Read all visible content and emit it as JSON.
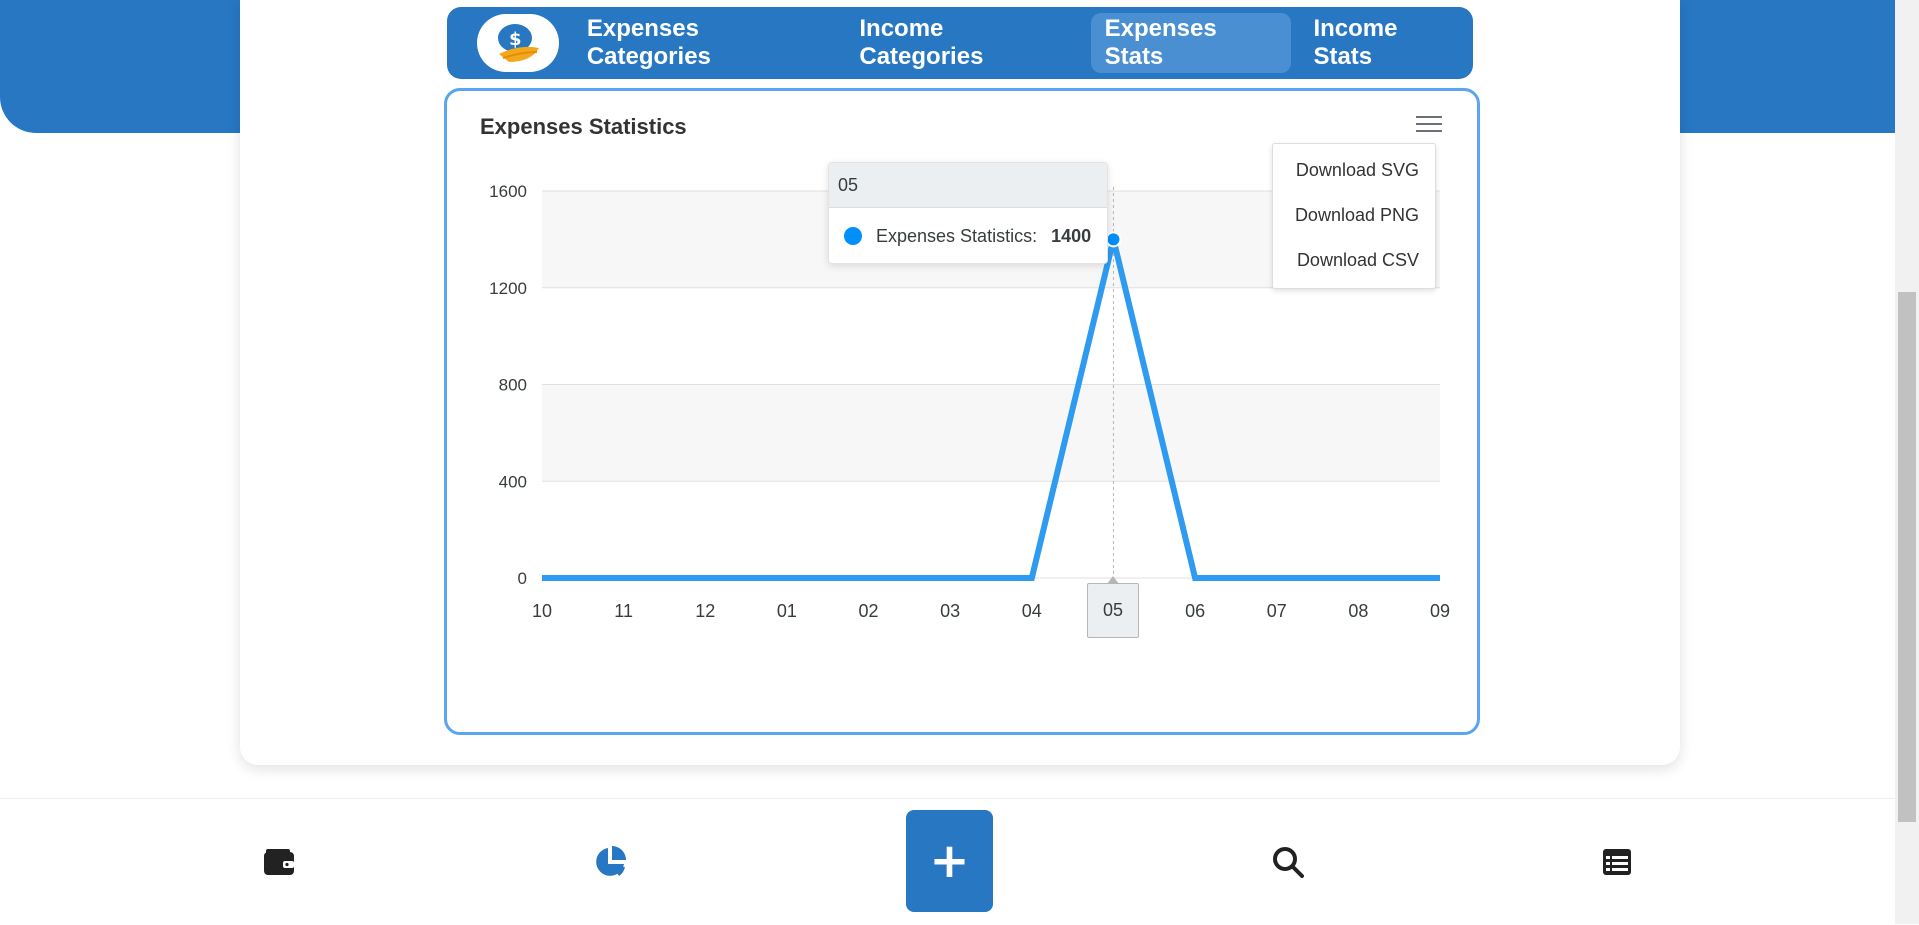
{
  "nav": {
    "tabs": [
      {
        "label": "Expenses Categories"
      },
      {
        "label": "Income Categories"
      },
      {
        "label": "Expenses Stats"
      },
      {
        "label": "Income Stats"
      }
    ],
    "active_tab": "Expenses Stats"
  },
  "chart_panel": {
    "title": "Expenses Statistics",
    "export_menu": [
      "Download SVG",
      "Download PNG",
      "Download CSV"
    ],
    "tooltip": {
      "header": "05",
      "series_label": "Expenses Statistics:",
      "value": "1400"
    },
    "xaxis_tooltip": "05"
  },
  "chart_data": {
    "type": "line",
    "title": "Expenses Statistics",
    "categories": [
      "10",
      "11",
      "12",
      "01",
      "02",
      "03",
      "04",
      "05",
      "06",
      "07",
      "08",
      "09"
    ],
    "series": [
      {
        "name": "Expenses Statistics",
        "values": [
          0,
          0,
          0,
          0,
          0,
          0,
          0,
          1400,
          0,
          0,
          0,
          0
        ]
      }
    ],
    "yticks": [
      0,
      400,
      800,
      1200,
      1600
    ],
    "ylim": [
      0,
      1600
    ],
    "grid": true,
    "line_color": "#2e9bf0",
    "highlighted_category": "05"
  },
  "bottom_nav": {
    "items": [
      "wallet-icon",
      "pie-chart-icon",
      "plus-icon",
      "search-icon",
      "list-icon"
    ],
    "add_label": "+"
  },
  "colors": {
    "primary": "#2777c3",
    "accent": "#5aa5ee",
    "series": "#2e9bf0"
  }
}
